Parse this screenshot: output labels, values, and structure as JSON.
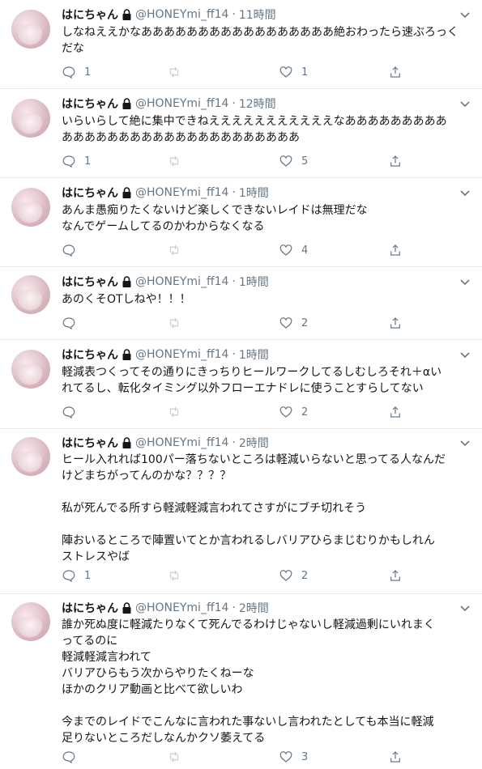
{
  "author": {
    "name": "はにちゃん",
    "handle": "@HONEYmi_ff14",
    "separator": "·"
  },
  "icons": {
    "lock": "lock-icon",
    "caret": "chevron-down-icon",
    "reply": "reply-icon",
    "retweet": "retweet-icon",
    "like": "heart-icon",
    "share": "share-icon"
  },
  "tweets": [
    {
      "time": "11時間",
      "text": "しなねええかなあああああああああああああああああ絶おわったら速ぶろっく\nだな",
      "reply_count": "1",
      "retweet_count": "",
      "like_count": "1"
    },
    {
      "time": "12時間",
      "text": "いらいらして絶に集中できねえええええええええええなあああああああああ\nあああああああああああああああああああああ",
      "reply_count": "1",
      "retweet_count": "",
      "like_count": "5"
    },
    {
      "time": "1時間",
      "text": "あんま愚痴りたくないけど楽しくできないレイドは無理だな\nなんでゲームしてるのかわからなくなる",
      "reply_count": "",
      "retweet_count": "",
      "like_count": "4"
    },
    {
      "time": "1時間",
      "text": "あのくそOTしねや！！！",
      "reply_count": "",
      "retweet_count": "",
      "like_count": "2"
    },
    {
      "time": "1時間",
      "text": "軽減表つくってその通りにきっちりヒールワークしてるしむしろそれ＋αい\nれてるし、転化タイミング以外フローエナドレに使うことすらしてない",
      "reply_count": "",
      "retweet_count": "",
      "like_count": "2"
    },
    {
      "time": "2時間",
      "text": "ヒール入れれば100パー落ちないところは軽減いらないと思ってる人なんだ\nけどまちがってんのかな？？？？\n\n私が死んでる所すら軽減軽減言われてさすがにブチ切れそう\n\n陣おいるところで陣置いてとか言われるしバリアひらまじむりかもしれん\nストレスやば",
      "reply_count": "1",
      "retweet_count": "",
      "like_count": "2"
    },
    {
      "time": "2時間",
      "text": "誰か死ぬ度に軽減たりなくて死んでるわけじゃないし軽減過剰にいれまく\nってるのに\n軽減軽減言われて\nバリアひらもう次からやりたくねーな\nほかのクリア動画と比べて欲しいわ\n\n今までのレイドでこんなに言われた事ないし言われたとしても本当に軽減\n足りないところだしなんかクソ萎えてる",
      "reply_count": "",
      "retweet_count": "",
      "like_count": "3"
    }
  ]
}
